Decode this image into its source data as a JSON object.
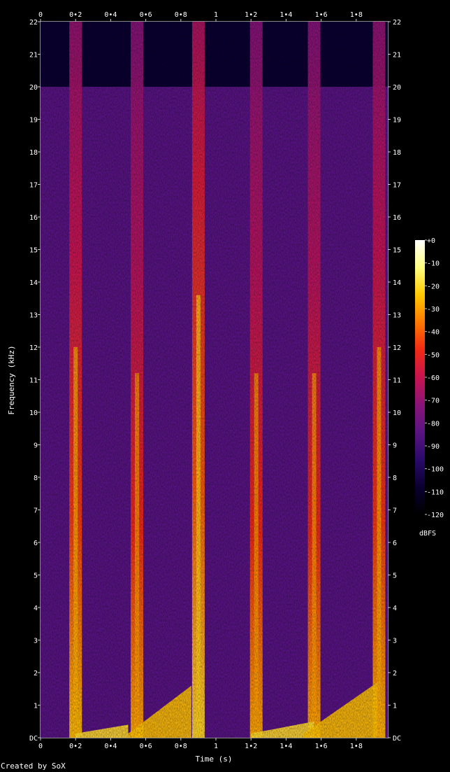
{
  "chart_data": {
    "type": "heatmap",
    "xlabel": "Time (s)",
    "ylabel": "Frequency (kHz)",
    "xlim": [
      0,
      1.98
    ],
    "ylim": [
      0,
      22
    ],
    "x_ticks": [
      {
        "value": 0,
        "label": "0"
      },
      {
        "value": 0.2,
        "label": "0•2"
      },
      {
        "value": 0.4,
        "label": "0•4"
      },
      {
        "value": 0.6,
        "label": "0•6"
      },
      {
        "value": 0.8,
        "label": "0•8"
      },
      {
        "value": 1.0,
        "label": "1"
      },
      {
        "value": 1.2,
        "label": "1•2"
      },
      {
        "value": 1.4,
        "label": "1•4"
      },
      {
        "value": 1.6,
        "label": "1•6"
      },
      {
        "value": 1.8,
        "label": "1•8"
      }
    ],
    "y_ticks": [
      {
        "value": 0,
        "label": "DC"
      },
      {
        "value": 1,
        "label": "1"
      },
      {
        "value": 2,
        "label": "2"
      },
      {
        "value": 3,
        "label": "3"
      },
      {
        "value": 4,
        "label": "4"
      },
      {
        "value": 5,
        "label": "5"
      },
      {
        "value": 6,
        "label": "6"
      },
      {
        "value": 7,
        "label": "7"
      },
      {
        "value": 8,
        "label": "8"
      },
      {
        "value": 9,
        "label": "9"
      },
      {
        "value": 10,
        "label": "10"
      },
      {
        "value": 11,
        "label": "11"
      },
      {
        "value": 12,
        "label": "12"
      },
      {
        "value": 13,
        "label": "13"
      },
      {
        "value": 14,
        "label": "14"
      },
      {
        "value": 15,
        "label": "15"
      },
      {
        "value": 16,
        "label": "16"
      },
      {
        "value": 17,
        "label": "17"
      },
      {
        "value": 18,
        "label": "18"
      },
      {
        "value": 19,
        "label": "19"
      },
      {
        "value": 20,
        "label": "20"
      },
      {
        "value": 21,
        "label": "21"
      },
      {
        "value": 22,
        "label": "22"
      }
    ],
    "colorbar": {
      "label": "dBFS",
      "range": [
        -120,
        0
      ],
      "ticks": [
        {
          "value": 0,
          "label": "+0"
        },
        {
          "value": -10,
          "label": "-10"
        },
        {
          "value": -20,
          "label": "-20"
        },
        {
          "value": -30,
          "label": "-30"
        },
        {
          "value": -40,
          "label": "-40"
        },
        {
          "value": -50,
          "label": "-50"
        },
        {
          "value": -60,
          "label": "-60"
        },
        {
          "value": -70,
          "label": "-70"
        },
        {
          "value": -80,
          "label": "-80"
        },
        {
          "value": -90,
          "label": "-90"
        },
        {
          "value": -100,
          "label": "-100"
        },
        {
          "value": -110,
          "label": "-110"
        },
        {
          "value": -120,
          "label": "-120"
        }
      ],
      "colors": [
        "#000000",
        "#0a0030",
        "#2a0a6a",
        "#5a1482",
        "#8a1478",
        "#c81450",
        "#f02a14",
        "#ff7800",
        "#ffc800",
        "#ffff80",
        "#ffffff"
      ]
    },
    "background_level_db": -85,
    "cutoff_khz": 20,
    "above_cutoff_level_db": -108,
    "onsets": [
      {
        "time": 0.2,
        "level_db": -45,
        "decay_khz": 15
      },
      {
        "time": 0.55,
        "level_db": -48,
        "decay_khz": 14
      },
      {
        "time": 0.9,
        "level_db": -40,
        "decay_khz": 17
      },
      {
        "time": 1.23,
        "level_db": -48,
        "decay_khz": 14
      },
      {
        "time": 1.56,
        "level_db": -48,
        "decay_khz": 14
      },
      {
        "time": 1.93,
        "level_db": -46,
        "decay_khz": 15
      }
    ],
    "low_band_events": [
      {
        "start": 0.2,
        "end": 0.5,
        "top_khz": 0.4,
        "level_db": -20
      },
      {
        "start": 0.5,
        "end": 0.86,
        "top_khz": 1.6,
        "level_db": -25
      },
      {
        "start": 1.2,
        "end": 1.56,
        "top_khz": 0.5,
        "level_db": -20
      },
      {
        "start": 1.5,
        "end": 1.92,
        "top_khz": 1.7,
        "level_db": -25
      }
    ]
  },
  "footer": "Created by SoX"
}
